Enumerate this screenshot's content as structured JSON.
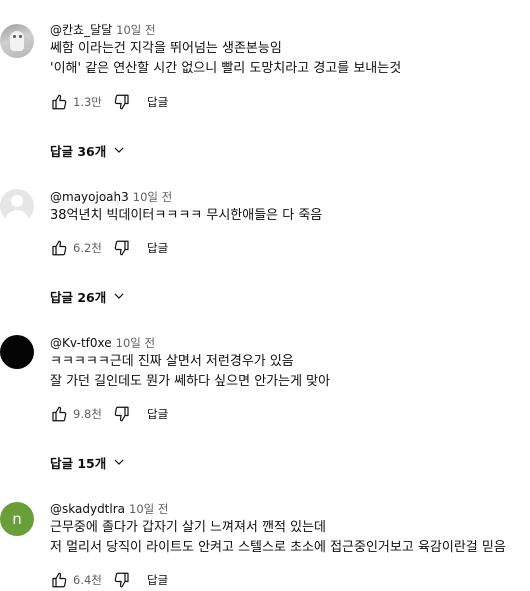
{
  "comments": [
    {
      "author": "@칸쵸_달달",
      "time": "10일 전",
      "lines": [
        "쎄함 이라는건 지각을 뛰어넘는 생존본능임",
        "'이해' 같은 연산할 시간 없으니 빨리 도망치라고 경고를 보내는것"
      ],
      "likes": "1.3만",
      "reply_label": "답글",
      "replies": "답글 36개"
    },
    {
      "author": "@mayojoah3",
      "time": "10일 전",
      "lines": [
        "38억년치 빅데이터ㅋㅋㅋㅋ 무시한애들은 다 죽음"
      ],
      "likes": "6.2천",
      "reply_label": "답글",
      "replies": "답글 26개"
    },
    {
      "author": "@Kv-tf0xe",
      "time": "10일 전",
      "lines": [
        "ㅋㅋㅋㅋㅋ근데 진짜 살면서 저런경우가 있음",
        "잘 가던 길인데도 뭔가 쎄하다 싶으면 안가는게 맞아"
      ],
      "likes": "9.8천",
      "reply_label": "답글",
      "replies": "답글 15개"
    },
    {
      "author": "@skadydtlra",
      "time": "10일 전",
      "avatar_letter": "n",
      "lines": [
        "근무중에 졸다가 갑자기 살기 느껴져서 깬적 있는데",
        "저 멀리서 당직이 라이트도 안켜고 스텔스로 초소에 접근중인거보고 육감이란걸 믿음"
      ],
      "likes": "6.4천",
      "reply_label": "답글"
    }
  ],
  "colors": {
    "text": "#0f0f0f",
    "secondary": "#606060",
    "avatar_green": "#689f38"
  }
}
